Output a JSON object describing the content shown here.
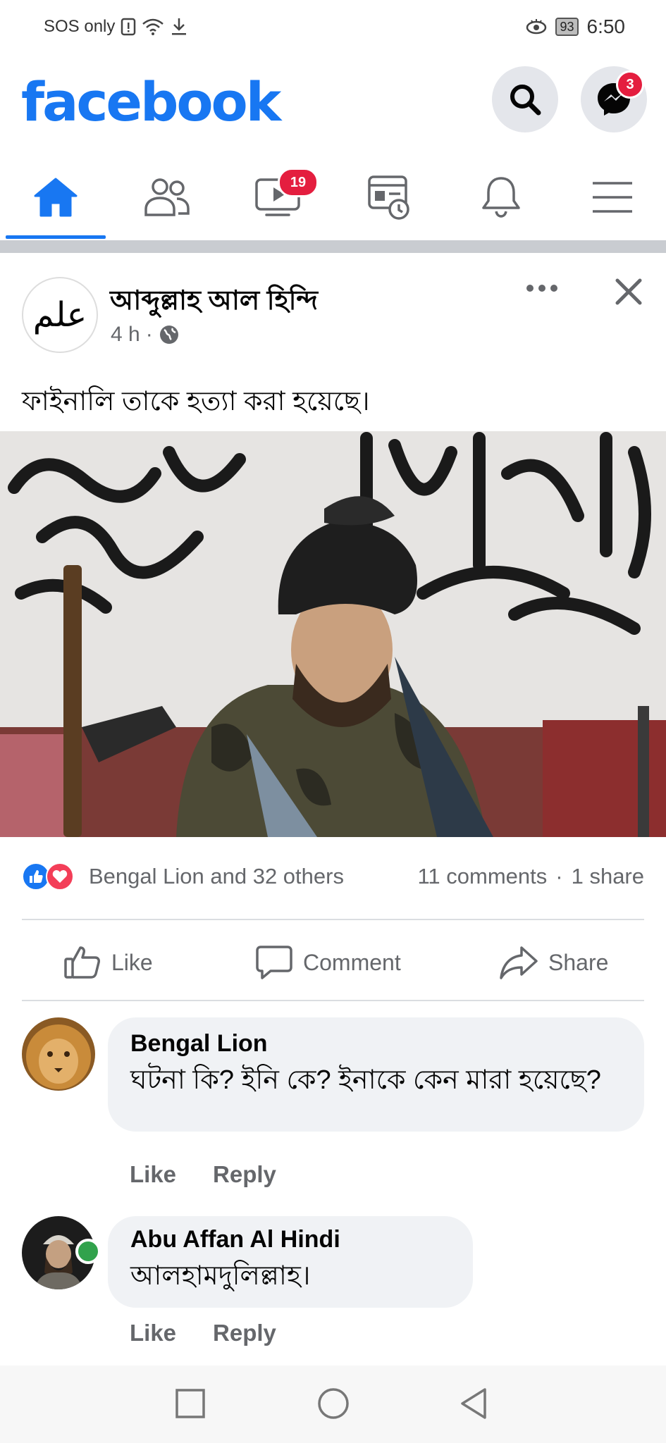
{
  "status_bar": {
    "left_text": "SOS only",
    "battery": "93",
    "time": "6:50"
  },
  "header": {
    "logo": "facebook",
    "messenger_badge": "3"
  },
  "nav": {
    "watch_badge": "19"
  },
  "post": {
    "page_avatar_text": "علم",
    "author": "আব্দুল্লাহ আল হিন্দি",
    "time": "4 h",
    "text": "ফাইনালি তাকে হত্যা করা হয়েছে।",
    "reactions_text": "Bengal Lion and 32 others",
    "comments_count": "11 comments",
    "shares_count": "1 share",
    "actions": {
      "like": "Like",
      "comment": "Comment",
      "share": "Share"
    }
  },
  "comments": [
    {
      "name": "Bengal Lion",
      "text": "ঘটনা কি? ইনি কে? ইনাকে কেন মারা হয়েছে?",
      "like": "Like",
      "reply": "Reply"
    },
    {
      "name": "Abu Affan Al Hindi",
      "text": "আলহামদুলিল্লাহ।",
      "like": "Like",
      "reply": "Reply"
    }
  ],
  "colors": {
    "brand": "#1877f2",
    "badge": "#e41e3f",
    "love": "#f33e58",
    "online": "#31a24c"
  }
}
